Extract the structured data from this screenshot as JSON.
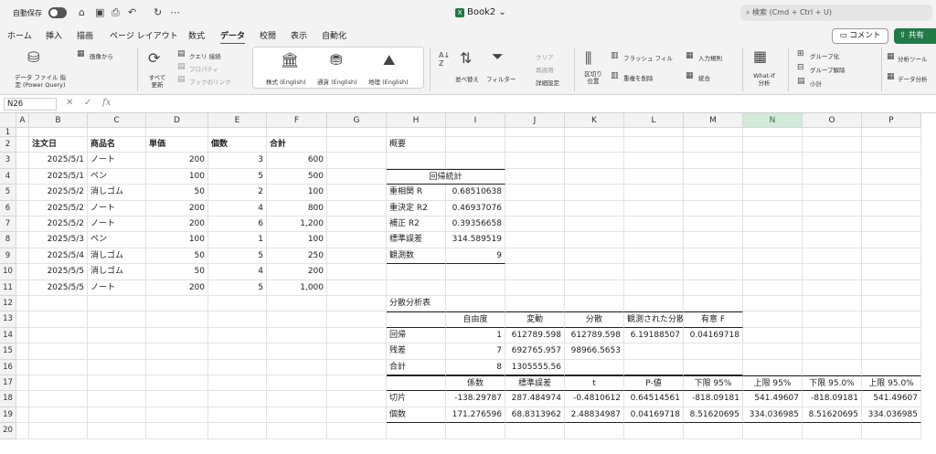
{
  "titlebar": {
    "autosave_label": "自動保存",
    "doc_title": "Book2",
    "search_placeholder": "検索 (Cmd + Ctrl + U)"
  },
  "menu": {
    "tabs": [
      "ホーム",
      "挿入",
      "描画",
      "ページ レイアウト",
      "数式",
      "データ",
      "校閲",
      "表示",
      "自動化"
    ],
    "active": "データ",
    "comment_label": "コメント",
    "share_label": "共有"
  },
  "ribbon": {
    "get_data": "データ ファイル 指定 (Power Query)",
    "from_image": "画像から",
    "refresh_all": "すべて 更新",
    "queries": "クエリ 接続",
    "properties": "プロパティ",
    "book_links": "ブックのリンク",
    "stocks": "株式 (English)",
    "currencies": "通貨 (English)",
    "geography": "地理 (English)",
    "sort": "並べ替え",
    "filter": "フィルター",
    "clear": "クリア",
    "reapply": "再適用",
    "advanced": "詳細設定",
    "text_to_columns": "区切り 位置",
    "flash_fill": "フラッシュ フィル",
    "remove_duplicates": "重複を削除",
    "data_validation": "入力規則",
    "consolidate": "統合",
    "what_if": "What-If 分析",
    "group": "グループ化",
    "ungroup": "グループ解除",
    "subtotal": "小計",
    "analysis_tools": "分析ツール",
    "data_analysis": "データ分析"
  },
  "formula_bar": {
    "name_box": "N26",
    "fx": "fx",
    "value": ""
  },
  "sheet": {
    "columns": [
      "A",
      "B",
      "C",
      "D",
      "E",
      "F",
      "G",
      "H",
      "I",
      "J",
      "K",
      "L",
      "M",
      "N",
      "O",
      "P"
    ],
    "selected_column": "N",
    "rows": [
      "1",
      "2",
      "3",
      "4",
      "5",
      "6",
      "7",
      "8",
      "9",
      "10",
      "11",
      "12",
      "13",
      "14",
      "15",
      "16",
      "17",
      "18",
      "19",
      "20"
    ],
    "orders": {
      "headers": [
        "注文日",
        "商品名",
        "単価",
        "個数",
        "合計"
      ],
      "rows": [
        [
          "2025/5/1",
          "ノート",
          "200",
          "3",
          "600"
        ],
        [
          "2025/5/1",
          "ペン",
          "100",
          "5",
          "500"
        ],
        [
          "2025/5/2",
          "消しゴム",
          "50",
          "2",
          "100"
        ],
        [
          "2025/5/2",
          "ノート",
          "200",
          "4",
          "800"
        ],
        [
          "2025/5/2",
          "ノート",
          "200",
          "6",
          "1,200"
        ],
        [
          "2025/5/3",
          "ペン",
          "100",
          "1",
          "100"
        ],
        [
          "2025/5/4",
          "消しゴム",
          "50",
          "5",
          "250"
        ],
        [
          "2025/5/5",
          "消しゴム",
          "50",
          "4",
          "200"
        ],
        [
          "2025/5/5",
          "ノート",
          "200",
          "5",
          "1,000"
        ]
      ]
    },
    "summary_label": "概要",
    "regression_stats": {
      "title": "回帰統計",
      "rows": [
        [
          "重相関 R",
          "0.68510638"
        ],
        [
          "重決定 R2",
          "0.46937076"
        ],
        [
          "補正 R2",
          "0.39356658"
        ],
        [
          "標準誤差",
          "314.589519"
        ],
        [
          "観測数",
          "9"
        ]
      ]
    },
    "anova": {
      "title": "分散分析表",
      "headers": [
        "自由度",
        "変動",
        "分散",
        "観測された分散比",
        "有意 F"
      ],
      "rows": [
        [
          "回帰",
          "1",
          "612789.598",
          "612789.598",
          "6.19188507",
          "0.04169718"
        ],
        [
          "残差",
          "7",
          "692765.957",
          "98966.5653",
          "",
          ""
        ],
        [
          "合計",
          "8",
          "1305555.56",
          "",
          "",
          ""
        ]
      ]
    },
    "coefficients": {
      "headers": [
        "係数",
        "標準誤差",
        "t",
        "P-値",
        "下限 95%",
        "上限 95%",
        "下限 95.0%",
        "上限 95.0%"
      ],
      "rows": [
        [
          "切片",
          "-138.29787",
          "287.484974",
          "-0.4810612",
          "0.64514561",
          "-818.09181",
          "541.49607",
          "-818.09181",
          "541.49607"
        ],
        [
          "個数",
          "171.276596",
          "68.8313962",
          "2.48834987",
          "0.04169718",
          "8.51620695",
          "334.036985",
          "8.51620695",
          "334.036985"
        ]
      ]
    }
  }
}
